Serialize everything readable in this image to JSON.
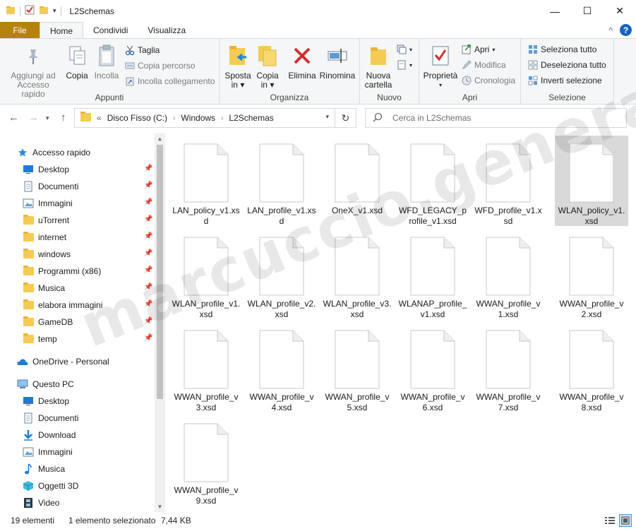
{
  "window": {
    "title": "L2Schemas",
    "minimize": "—",
    "maximize": "☐",
    "close": "✕"
  },
  "tabs": {
    "file": "File",
    "home": "Home",
    "share": "Condividi",
    "view": "Visualizza",
    "collapse": "^",
    "help": "?"
  },
  "ribbon": {
    "appunti": {
      "label": "Appunti",
      "pin_quick": "Aggiungi ad Accesso rapido",
      "copy": "Copia",
      "paste": "Incolla",
      "cut": "Taglia",
      "copy_path": "Copia percorso",
      "paste_link": "Incolla collegamento"
    },
    "organizza": {
      "label": "Organizza",
      "move": "Sposta in",
      "copy_to": "Copia in",
      "delete": "Elimina",
      "rename": "Rinomina"
    },
    "nuovo": {
      "label": "Nuovo",
      "new_folder": "Nuova cartella"
    },
    "apri": {
      "label": "Apri",
      "properties": "Proprietà",
      "open": "Apri",
      "edit": "Modifica",
      "history": "Cronologia"
    },
    "seleziona": {
      "label": "Selezione",
      "select_all": "Seleziona tutto",
      "select_none": "Deseleziona tutto",
      "invert": "Inverti selezione"
    }
  },
  "address": {
    "overflow": "«",
    "crumbs": [
      "Disco Fisso (C:)",
      "Windows",
      "L2Schemas"
    ],
    "search_placeholder": "Cerca in L2Schemas"
  },
  "sidebar": {
    "quick_access": "Accesso rapido",
    "quick_items": [
      "Desktop",
      "Documenti",
      "Immagini",
      "uTorrent",
      "internet",
      "windows",
      "Programmi (x86)",
      "Musica",
      "elabora immagini",
      "GameDB",
      "temp"
    ],
    "onedrive": "OneDrive - Personal",
    "this_pc": "Questo PC",
    "pc_items": [
      "Desktop",
      "Documenti",
      "Download",
      "Immagini",
      "Musica",
      "Oggetti 3D",
      "Video"
    ]
  },
  "files": [
    "LAN_policy_v1.xsd",
    "LAN_profile_v1.xsd",
    "OneX_v1.xsd",
    "WFD_LEGACY_profile_v1.xsd",
    "WFD_profile_v1.xsd",
    "WLAN_policy_v1.xsd",
    "WLAN_profile_v1.xsd",
    "WLAN_profile_v2.xsd",
    "WLAN_profile_v3.xsd",
    "WLANAP_profile_v1.xsd",
    "WWAN_profile_v1.xsd",
    "WWAN_profile_v2.xsd",
    "WWAN_profile_v3.xsd",
    "WWAN_profile_v4.xsd",
    "WWAN_profile_v5.xsd",
    "WWAN_profile_v6.xsd",
    "WWAN_profile_v7.xsd",
    "WWAN_profile_v8.xsd",
    "WWAN_profile_v9.xsd"
  ],
  "selected_file": "WLAN_policy_v1.xsd",
  "watermark": "marcuccio.generali",
  "status": {
    "count": "19 elementi",
    "selected": "1 elemento selezionato",
    "size": "7,44 KB"
  },
  "colors": {
    "file_tab": "#b5820e",
    "accent_blue": "#1565c0",
    "selection": "#d9d9d9",
    "folder": "#f4cc55"
  }
}
